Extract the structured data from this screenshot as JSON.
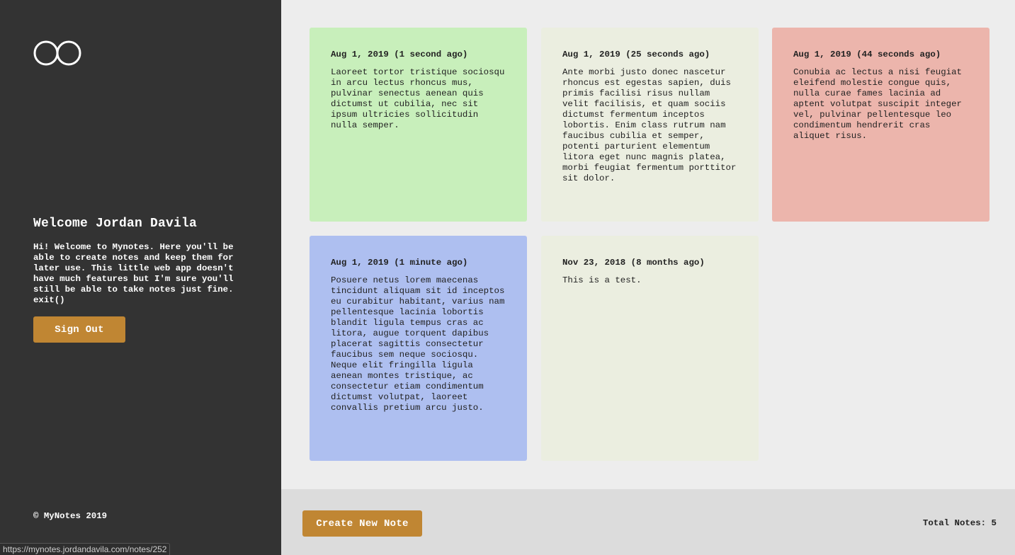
{
  "sidebar": {
    "logo_icon": "infinity-loop-logo-icon",
    "welcome_title": "Welcome Jordan Davila",
    "welcome_text": "Hi! Welcome to Mynotes. Here you'll be able to create notes and keep them for later use. This little web app doesn't have much features but I'm sure you'll still be able to take notes just fine. exit()",
    "signout_label": "Sign Out",
    "copyright": "© MyNotes 2019"
  },
  "notes": [
    {
      "date": "Aug 1, 2019 (1 second ago)",
      "body": "Laoreet tortor tristique sociosqu in arcu lectus rhoncus mus, pulvinar senectus aenean quis dictumst ut cubilia, nec sit ipsum ultricies sollicitudin nulla semper.",
      "color": "#c8efbb"
    },
    {
      "date": "Aug 1, 2019 (25 seconds ago)",
      "body": "Ante morbi justo donec nascetur rhoncus est egestas sapien, duis primis facilisi risus nullam velit facilisis, et quam sociis dictumst fermentum inceptos lobortis. Enim class rutrum nam faucibus cubilia et semper, potenti parturient elementum litora eget nunc magnis platea, morbi feugiat fermentum porttitor sit dolor.",
      "color": "#ebeee0"
    },
    {
      "date": "Aug 1, 2019 (44 seconds ago)",
      "body": "Conubia ac lectus a nisi feugiat eleifend molestie congue quis, nulla curae fames lacinia ad aptent volutpat suscipit integer vel, pulvinar pellentesque leo condimentum hendrerit cras aliquet risus.",
      "color": "#ecb5ac"
    },
    {
      "date": "Aug 1, 2019 (1 minute ago)",
      "body": "Posuere netus lorem maecenas tincidunt aliquam sit id inceptos eu curabitur habitant, varius nam pellentesque lacinia lobortis blandit ligula tempus cras ac litora, augue torquent dapibus placerat sagittis consectetur faucibus sem neque sociosqu. Neque elit fringilla ligula aenean montes tristique, ac consectetur etiam condimentum dictumst volutpat, laoreet convallis pretium arcu justo.",
      "color": "#aebff0"
    },
    {
      "date": "Nov 23, 2018 (8 months ago)",
      "body": "This is a test.",
      "color": "#ebeee0"
    }
  ],
  "footer": {
    "create_label": "Create New Note",
    "total_notes": "Total Notes: 5"
  },
  "browser": {
    "status_url": "https://mynotes.jordandavila.com/notes/252"
  },
  "colors": {
    "sidebar_bg": "#333333",
    "accent_button": "#c08633",
    "main_bg": "#ededed",
    "footer_bg": "#dcdcdc"
  }
}
